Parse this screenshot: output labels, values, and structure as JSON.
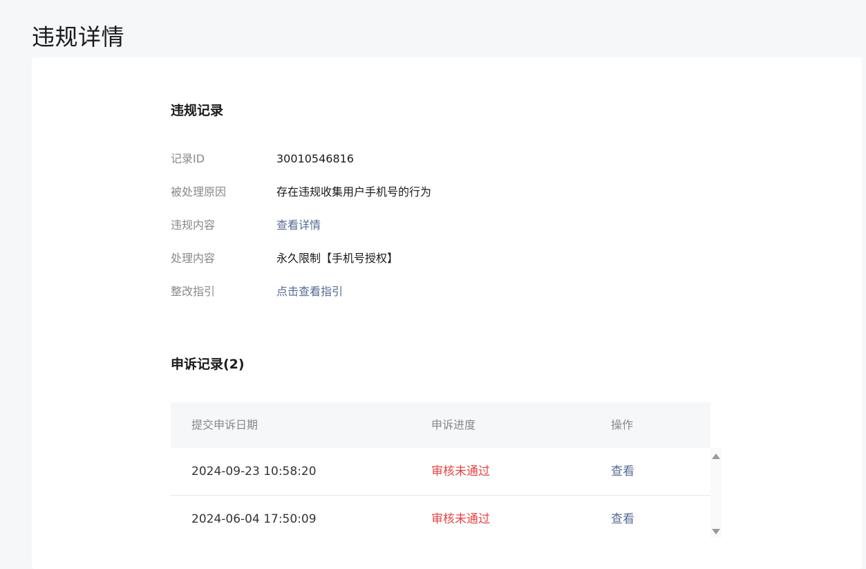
{
  "page": {
    "title": "违规详情"
  },
  "violation": {
    "section_title": "违规记录",
    "rows": [
      {
        "label": "记录ID",
        "value": "30010546816",
        "is_link": false
      },
      {
        "label": "被处理原因",
        "value": "存在违规收集用户手机号的行为",
        "is_link": false
      },
      {
        "label": "违规内容",
        "value": "查看详情",
        "is_link": true
      },
      {
        "label": "处理内容",
        "value": "永久限制【手机号授权】",
        "is_link": false
      },
      {
        "label": "整改指引",
        "value": "点击查看指引",
        "is_link": true
      }
    ]
  },
  "appeals": {
    "section_title": "申诉记录(2)",
    "columns": [
      "提交申诉日期",
      "申诉进度",
      "操作"
    ],
    "rows": [
      {
        "date": "2024-09-23 10:58:20",
        "status": "审核未通过",
        "action": "查看"
      },
      {
        "date": "2024-06-04 17:50:09",
        "status": "审核未通过",
        "action": "查看"
      }
    ]
  },
  "colors": {
    "background": "#f6f7f9",
    "card": "#ffffff",
    "link": "#576b95",
    "rejected": "#e64340",
    "label": "#888888"
  }
}
